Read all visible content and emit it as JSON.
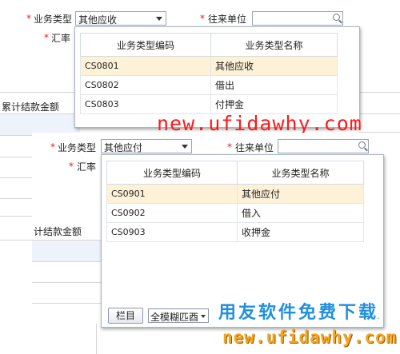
{
  "back_form": {
    "business_type_label": "业务类型",
    "business_type_value": "其他应收",
    "counterparty_label": "往来单位",
    "rate_label": "汇率",
    "cumulative_label": "累计结款金额",
    "required_mark": "*"
  },
  "back_dropdown": {
    "headers": [
      "业务类型编码",
      "业务类型名称"
    ],
    "rows": [
      {
        "code": "CS0801",
        "name": "其他应收"
      },
      {
        "code": "CS0802",
        "name": "借出"
      },
      {
        "code": "CS0803",
        "name": "付押金"
      }
    ]
  },
  "front_form": {
    "business_type_label": "业务类型",
    "business_type_value": "其他应付",
    "counterparty_label": "往来单位",
    "rate_label": "汇率",
    "cumulative_label": "计结款金额",
    "required_mark": "*"
  },
  "front_dropdown": {
    "headers": [
      "业务类型编码",
      "业务类型名称"
    ],
    "rows": [
      {
        "code": "CS0901",
        "name": "其他应付"
      },
      {
        "code": "CS0902",
        "name": "借入"
      },
      {
        "code": "CS0903",
        "name": "收押金"
      }
    ],
    "column_button": "栏目",
    "match_mode": "全模糊匹酉",
    "more": "..."
  },
  "watermarks": {
    "url_red": "new.ufidawhy.com",
    "brand_blue": "用友软件免费下载",
    "url_orange": "new.ufidawhy.com"
  }
}
